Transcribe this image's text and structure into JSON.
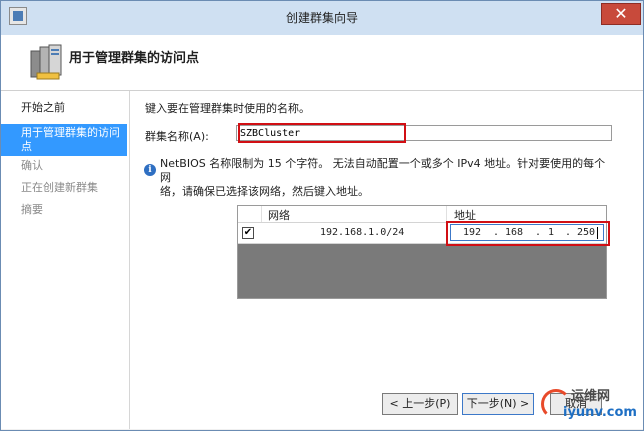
{
  "window": {
    "title": "创建群集向导",
    "close_glyph": "✕"
  },
  "header": {
    "title": "用于管理群集的访问点"
  },
  "steps": [
    {
      "label": "开始之前",
      "state": "normal"
    },
    {
      "label": "用于管理群集的访问",
      "label_line2": "点",
      "state": "selected"
    },
    {
      "label": "确认",
      "state": "disabled"
    },
    {
      "label": "正在创建新群集",
      "state": "disabled"
    },
    {
      "label": "摘要",
      "state": "disabled"
    }
  ],
  "content": {
    "instruction": "键入要在管理群集时使用的名称。",
    "cluster_name_label": "群集名称(A):",
    "cluster_name_value": "SZBCluster",
    "info_line1": "NetBIOS 名称限制为 15 个字符。 无法自动配置一个或多个 IPv4 地址。针对要使用的每个网",
    "info_line2": "络，请确保已选择该网络，然后键入地址。"
  },
  "network_table": {
    "headers": {
      "network": "网络",
      "address": "地址"
    },
    "rows": [
      {
        "checked": true,
        "check_glyph": "✔",
        "network": "192.168.1.0/24",
        "address_octets": [
          "192",
          "168",
          "1",
          "250"
        ],
        "address_separator": "."
      }
    ]
  },
  "buttons": {
    "back": "< 上一步(P)",
    "next": "下一步(N) >",
    "cancel": "取消"
  },
  "watermark": {
    "site_name": "运维网",
    "url": "iyunv.com"
  },
  "colors": {
    "selection": "#3399ff",
    "highlight_box": "#d10f14",
    "table_empty": "#7a7a7a"
  }
}
